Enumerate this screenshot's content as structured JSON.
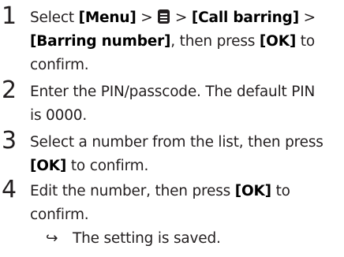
{
  "steps": [
    {
      "number": "1",
      "line1": {
        "t1": "Select ",
        "b1": "[Menu]",
        "t2": " > ",
        "icon": "phonebook-icon",
        "t3": " > ",
        "b2": "[Call barring]",
        "t4": " >"
      },
      "line2": {
        "b1": "[Barring number]",
        "t1": ", then press ",
        "b2": "[OK]",
        "t2": " to"
      },
      "line3": "confirm."
    },
    {
      "number": "2",
      "line1": "Enter the PIN/passcode. The default PIN",
      "line2": "is 0000."
    },
    {
      "number": "3",
      "line1": "Select a number from the list, then press",
      "line2": {
        "b1": "[OK]",
        "t1": " to confirm."
      }
    },
    {
      "number": "4",
      "line1": {
        "t1": "Edit the number, then press ",
        "b1": "[OK]",
        "t2": " to"
      },
      "line2": "confirm.",
      "result": {
        "arrow": "↪",
        "text": "The setting is saved."
      }
    }
  ],
  "colors": {
    "text": "#231f20"
  }
}
